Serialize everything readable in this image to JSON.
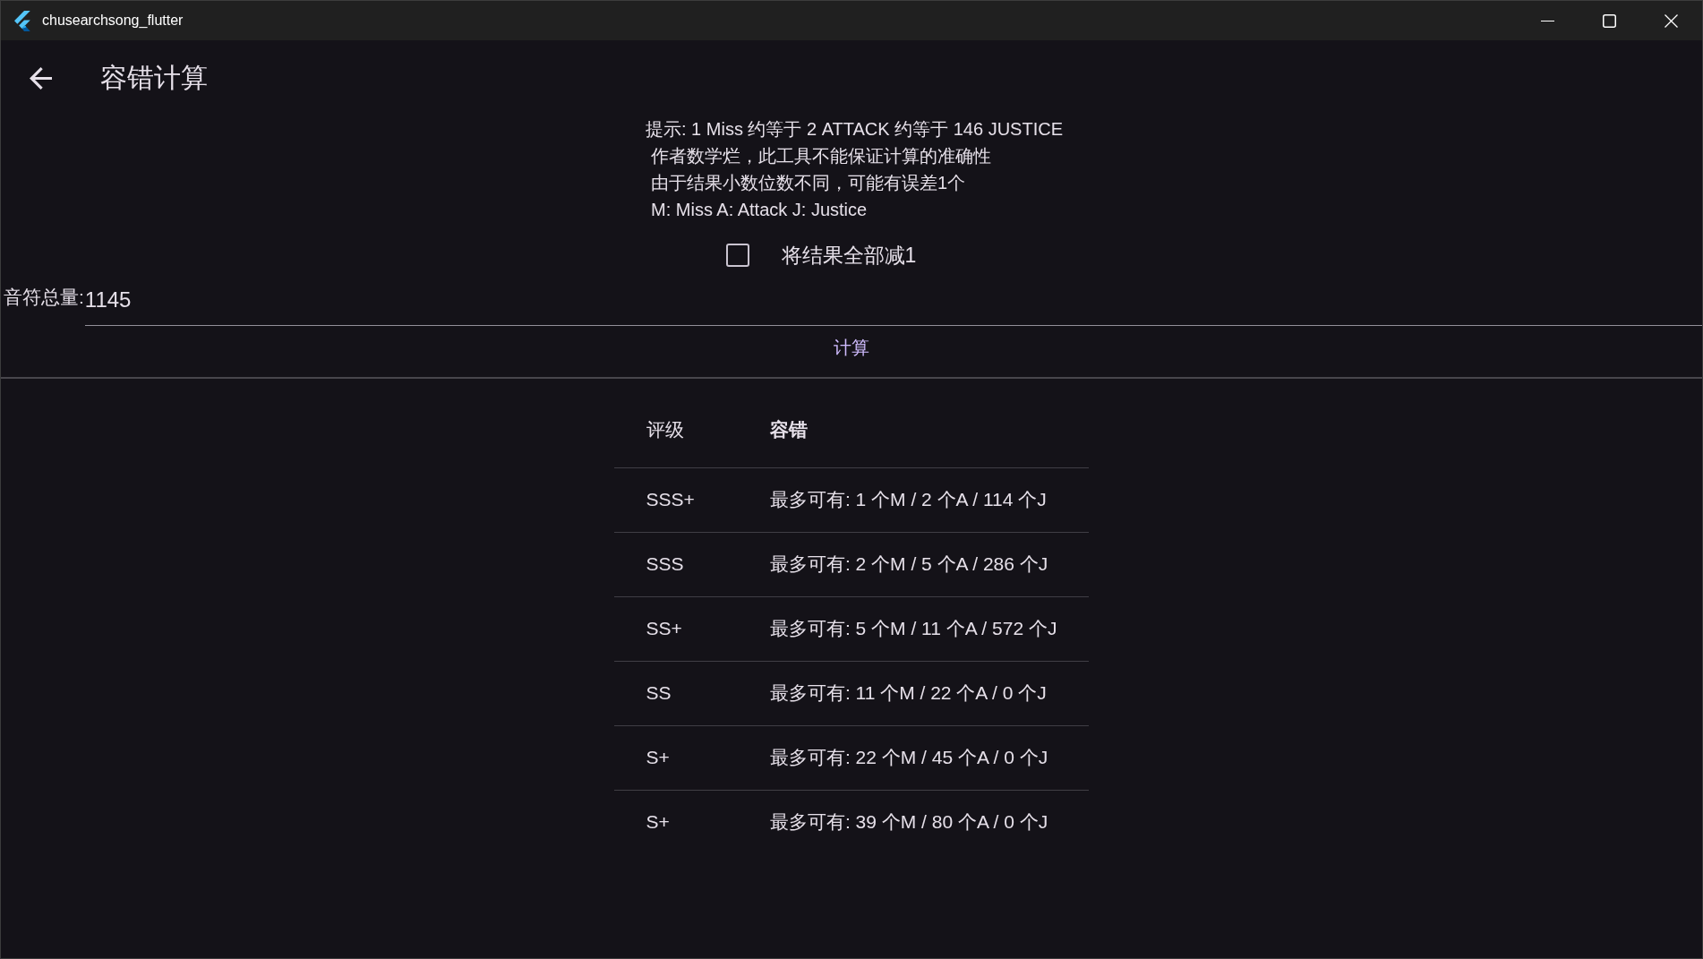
{
  "window": {
    "title": "chusearchsong_flutter"
  },
  "app_bar": {
    "title": "容错计算"
  },
  "hints": [
    "提示: 1 Miss 约等于 2 ATTACK 约等于 146 JUSTICE",
    "作者数学烂，此工具不能保证计算的准确性",
    "由于结果小数位数不同，可能有误差1个",
    "M: Miss A: Attack J: Justice"
  ],
  "minus_one": {
    "label": "将结果全部减1",
    "checked": false
  },
  "note_total": {
    "label": "音符总量:",
    "value": "1145"
  },
  "calculate_button": "计算",
  "table": {
    "columns": [
      {
        "label": "评级",
        "bold": false
      },
      {
        "label": "容错",
        "bold": true
      }
    ],
    "rows": [
      {
        "rank": "SSS+",
        "tolerance": "最多可有: 1 个M / 2 个A / 114 个J"
      },
      {
        "rank": "SSS",
        "tolerance": "最多可有: 2 个M / 5 个A / 286 个J"
      },
      {
        "rank": "SS+",
        "tolerance": "最多可有: 5 个M / 11 个A / 572 个J"
      },
      {
        "rank": "SS",
        "tolerance": "最多可有: 11 个M / 22 个A / 0 个J"
      },
      {
        "rank": "S+",
        "tolerance": "最多可有: 22 个M / 45 个A / 0 个J"
      },
      {
        "rank": "S+",
        "tolerance": "最多可有: 39 个M / 80 个A / 0 个J"
      }
    ]
  }
}
